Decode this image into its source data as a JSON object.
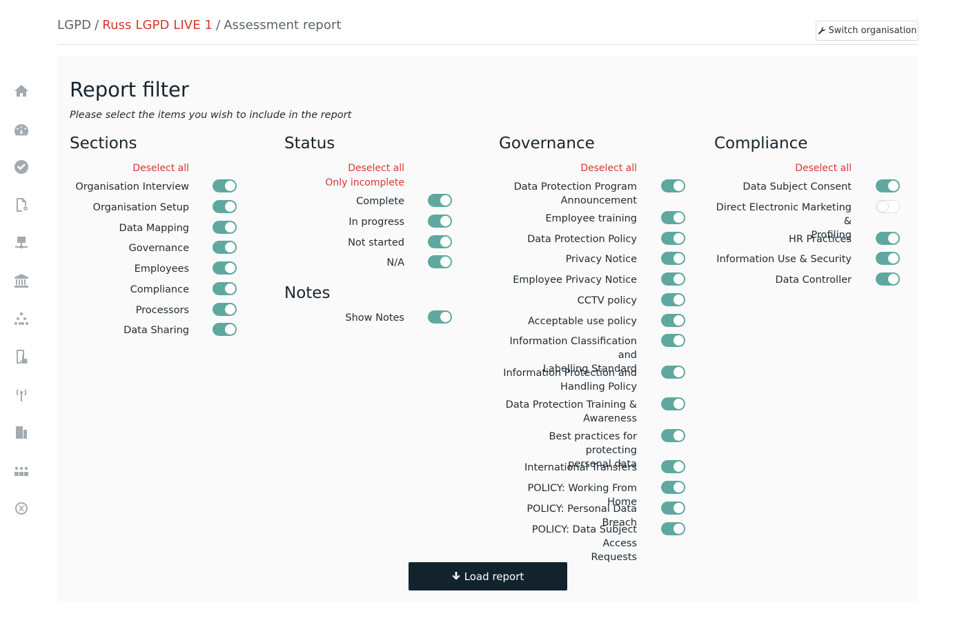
{
  "breadcrumb": {
    "root": "LGPD",
    "org": "Russ LGPD LIVE 1",
    "page": "Assessment report",
    "separator": "/"
  },
  "header": {
    "switch_label": "Switch organisation"
  },
  "sidebar": {
    "icons": [
      "home-icon",
      "dashboard-icon",
      "check-circle-icon",
      "document-settings-icon",
      "network-icon",
      "bank-icon",
      "org-chart-icon",
      "touch-document-icon",
      "broadcast-icon",
      "building-icon",
      "team-icon",
      "shuffle-icon"
    ]
  },
  "panel": {
    "title": "Report filter",
    "subtitle": "Please select the items you wish to include in the report"
  },
  "sections": {
    "title": "Sections",
    "deselect": "Deselect all",
    "items": [
      {
        "label": "Organisation Interview",
        "on": true
      },
      {
        "label": "Organisation Setup",
        "on": true
      },
      {
        "label": "Data Mapping",
        "on": true
      },
      {
        "label": "Governance",
        "on": true
      },
      {
        "label": "Employees",
        "on": true
      },
      {
        "label": "Compliance",
        "on": true
      },
      {
        "label": "Processors",
        "on": true
      },
      {
        "label": "Data Sharing",
        "on": true
      }
    ]
  },
  "status": {
    "title": "Status",
    "deselect": "Deselect all",
    "only_incomplete": "Only incomplete",
    "items": [
      {
        "label": "Complete",
        "on": true
      },
      {
        "label": "In progress",
        "on": true
      },
      {
        "label": "Not started",
        "on": true
      },
      {
        "label": "N/A",
        "on": true
      }
    ]
  },
  "notes": {
    "title": "Notes",
    "items": [
      {
        "label": "Show Notes",
        "on": true
      }
    ]
  },
  "governance": {
    "title": "Governance",
    "deselect": "Deselect all",
    "items": [
      {
        "line1": "Data Protection Program",
        "line2": "Announcement",
        "on": true
      },
      {
        "line1": "Employee training",
        "line2": "",
        "on": true
      },
      {
        "line1": "Data Protection Policy",
        "line2": "",
        "on": true
      },
      {
        "line1": "Privacy Notice",
        "line2": "",
        "on": true
      },
      {
        "line1": "Employee Privacy Notice",
        "line2": "",
        "on": true
      },
      {
        "line1": "CCTV policy",
        "line2": "",
        "on": true
      },
      {
        "line1": "Acceptable use policy",
        "line2": "",
        "on": true
      },
      {
        "line1": "Information Classification and",
        "line2": "Labelling Standard",
        "on": true
      },
      {
        "line1": "Information Protection and",
        "line2": "Handling Policy",
        "on": true
      },
      {
        "line1": "Data Protection Training &",
        "line2": "Awareness",
        "on": true
      },
      {
        "line1": "Best practices for protecting",
        "line2": "personal data",
        "on": true
      },
      {
        "line1": "International Transfers",
        "line2": "",
        "on": true
      },
      {
        "line1": "POLICY: Working From Home",
        "line2": "",
        "on": true
      },
      {
        "line1": "POLICY: Personal Data Breach",
        "line2": "",
        "on": true
      },
      {
        "line1": "POLICY: Data Subject Access",
        "line2": "Requests",
        "on": true
      }
    ]
  },
  "compliance": {
    "title": "Compliance",
    "deselect": "Deselect all",
    "items": [
      {
        "line1": "Data Subject Consent",
        "line2": "",
        "on": true
      },
      {
        "line1": "Direct Electronic Marketing &",
        "line2": "Profiling",
        "on": false
      },
      {
        "line1": "HR Practices",
        "line2": "",
        "on": true
      },
      {
        "line1": "Information Use & Security",
        "line2": "",
        "on": true
      },
      {
        "line1": "Data Controller",
        "line2": "",
        "on": true
      }
    ]
  },
  "load_button": "Load report"
}
